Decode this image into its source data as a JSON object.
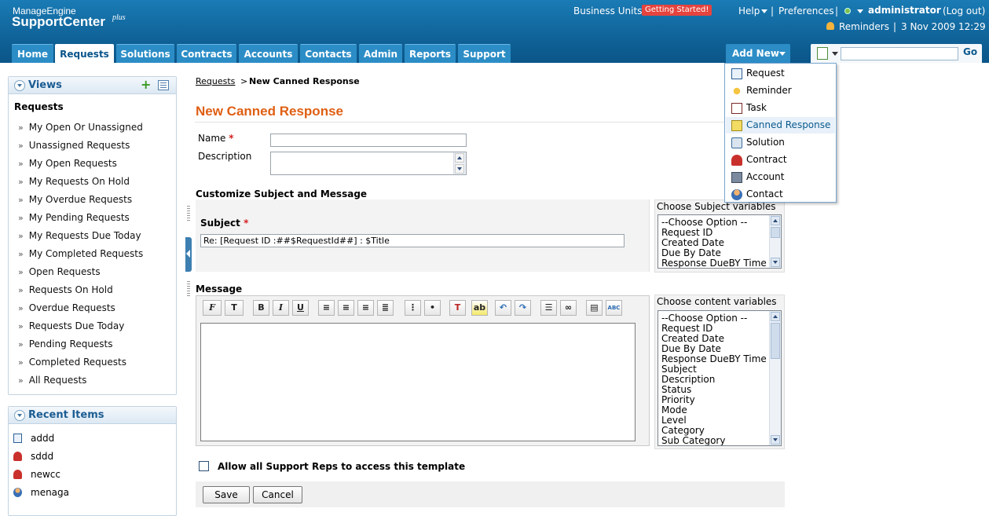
{
  "header": {
    "brand_top": "ManageEngine",
    "brand_main": "SupportCenter",
    "brand_sup": "plus",
    "business_units": "Business Units",
    "getting_started": "Getting Started!",
    "help": "Help",
    "sep1": "|",
    "preferences": "Preferences",
    "sep2": "|",
    "user": "administrator",
    "logout": "(Log out)",
    "reminders": "Reminders",
    "sep3": "|",
    "datetime": "3 Nov 2009 12:29"
  },
  "tabs": [
    {
      "label": "Home"
    },
    {
      "label": "Requests",
      "active": true
    },
    {
      "label": "Solutions"
    },
    {
      "label": "Contracts"
    },
    {
      "label": "Accounts"
    },
    {
      "label": "Contacts"
    },
    {
      "label": "Admin"
    },
    {
      "label": "Reports"
    },
    {
      "label": "Support"
    }
  ],
  "add_new": {
    "label": "Add New",
    "items": [
      {
        "label": "Request",
        "icon": "request-icon"
      },
      {
        "label": "Reminder",
        "icon": "reminder-icon"
      },
      {
        "label": "Task",
        "icon": "task-icon"
      },
      {
        "label": "Canned Response",
        "icon": "canned-response-icon",
        "highlighted": true
      },
      {
        "label": "Solution",
        "icon": "solution-icon"
      },
      {
        "label": "Contract",
        "icon": "contract-icon"
      },
      {
        "label": "Account",
        "icon": "account-icon"
      },
      {
        "label": "Contact",
        "icon": "contact-icon"
      }
    ]
  },
  "quick_search": {
    "go": "Go",
    "value": ""
  },
  "views": {
    "title": "Views",
    "heading": "Requests",
    "items": [
      "My Open Or Unassigned",
      "Unassigned Requests",
      "My Open Requests",
      "My Requests On Hold",
      "My Overdue Requests",
      "My Pending Requests",
      "My Requests Due Today",
      "My Completed Requests",
      "Open Requests",
      "Requests On Hold",
      "Overdue Requests",
      "Requests Due Today",
      "Pending Requests",
      "Completed Requests",
      "All Requests"
    ]
  },
  "recent": {
    "title": "Recent Items",
    "items": [
      {
        "label": "addd",
        "icon": "request-icon"
      },
      {
        "label": "sddd",
        "icon": "contract-icon"
      },
      {
        "label": "newcc",
        "icon": "contract-icon"
      },
      {
        "label": "menaga",
        "icon": "contact-icon"
      }
    ]
  },
  "breadcrumb": {
    "link": "Requests",
    "sep": ">",
    "current": "New Canned Response"
  },
  "form": {
    "title": "New Canned Response",
    "name_label": "Name",
    "required_mark": "*",
    "name_value": "",
    "description_label": "Description",
    "description_value": "",
    "customize_title": "Customize Subject and Message",
    "subject_label": "Subject",
    "subject_value": "Re: [Request ID :##$RequestId##] : $Title",
    "subject_vars_label": "Choose Subject variables",
    "subject_vars": [
      "--Choose Option --",
      "Request ID",
      "Created Date",
      "Due By Date",
      "Response DueBY Time"
    ],
    "message_label": "Message",
    "content_vars_label": "Choose content variables",
    "content_vars": [
      "--Choose Option --",
      "Request ID",
      "Created Date",
      "Due By Date",
      "Response DueBY Time",
      "Subject",
      "Description",
      "Status",
      "Priority",
      "Mode",
      "Level",
      "Category",
      "Sub Category"
    ],
    "message_value": "",
    "allow_label": "Allow all Support Reps to access this template",
    "save": "Save",
    "cancel": "Cancel"
  },
  "toolbar": {
    "font": "F",
    "size": "T",
    "bold": "B",
    "italic": "I",
    "underline": "U",
    "spell": "ABC"
  }
}
